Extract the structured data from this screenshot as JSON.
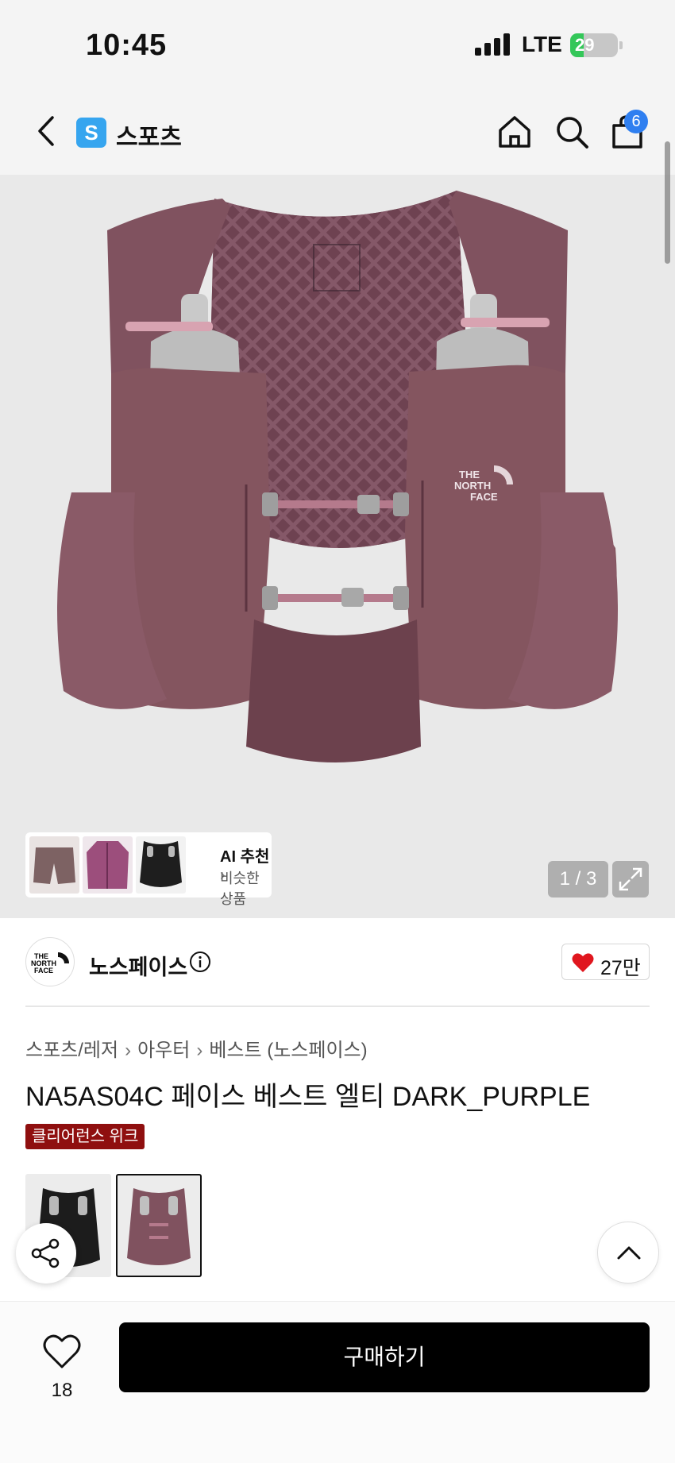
{
  "status_bar": {
    "time": "10:45",
    "network": "LTE",
    "battery": "29",
    "battery_level": 0.29
  },
  "nav": {
    "store_logo_letter": "S",
    "store_name": "스포츠",
    "cart_count": "6"
  },
  "gallery": {
    "counter": "1 / 3",
    "ai_card": {
      "title": "AI 추천",
      "subtitle": "비슷한 상품"
    },
    "product_logo_text": [
      "THE",
      "NORTH",
      "FACE"
    ]
  },
  "brand": {
    "name": "노스페이스",
    "likes": "27만",
    "logo_text": [
      "THE",
      "NORTH",
      "FACE"
    ]
  },
  "breadcrumb": [
    "스포츠/레저",
    "아우터",
    "베스트 (노스페이스)"
  ],
  "product": {
    "title": "NA5AS04C 페이스 베스트 엘티 DARK_PURPLE",
    "badge": "클리어런스 위크"
  },
  "bottom_bar": {
    "wish_count": "18",
    "buy_label": "구매하기"
  },
  "colors": {
    "vest": "#80525f",
    "vest_dark": "#6a3f4b",
    "accent_blue": "#2f7ff0",
    "badge_red": "#8f0f0f"
  }
}
